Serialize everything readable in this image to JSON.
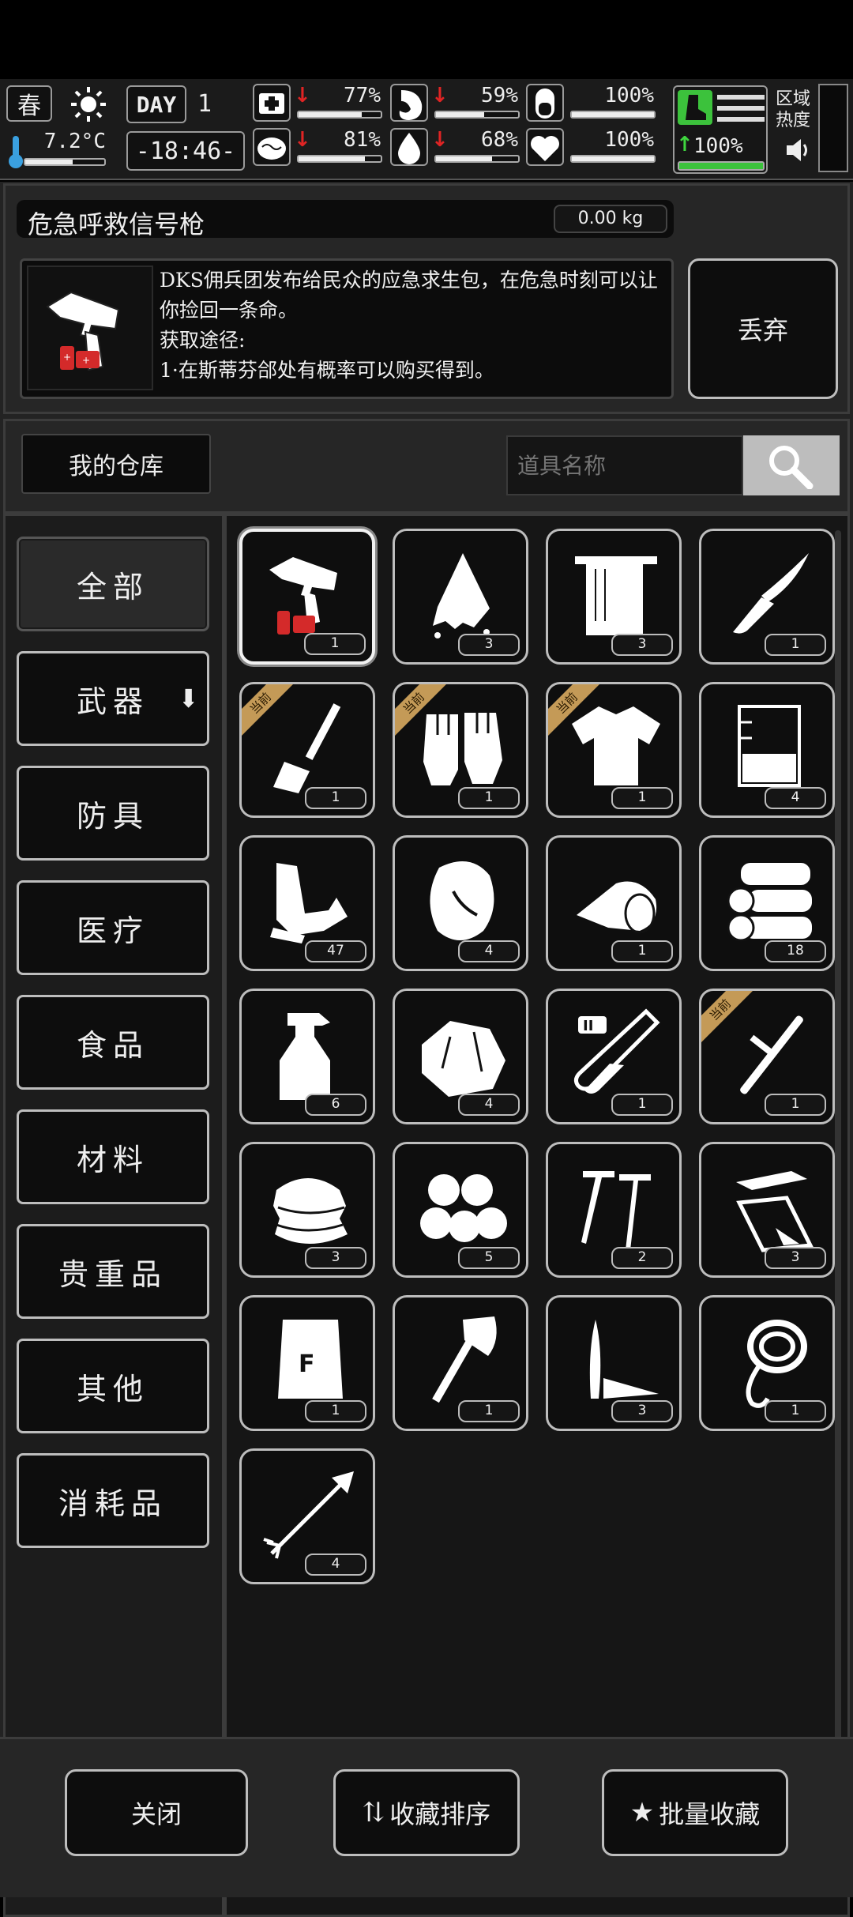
{
  "status": {
    "season": "春",
    "temperature": "7.2°C",
    "day_label": "DAY",
    "day_number": "1",
    "clock": "-18:46-",
    "stats": [
      {
        "icon": "medkit-icon",
        "value": "77%",
        "level": 0.77,
        "trend": "down"
      },
      {
        "icon": "stomach-icon",
        "value": "59%",
        "level": 0.59,
        "trend": "down"
      },
      {
        "icon": "pill-icon",
        "value": "100%",
        "level": 1.0,
        "trend": ""
      },
      {
        "icon": "brain-icon",
        "value": "81%",
        "level": 0.81,
        "trend": "down"
      },
      {
        "icon": "water-drop-icon",
        "value": "68%",
        "level": 0.68,
        "trend": "down"
      },
      {
        "icon": "heart-icon",
        "value": "100%",
        "level": 1.0,
        "trend": ""
      }
    ],
    "stamina": {
      "value": "100%",
      "level": 1.0,
      "trend": "up"
    },
    "zone_label": "区域热度"
  },
  "item": {
    "name": "危急呼救信号枪",
    "weight": "0.00 kg",
    "description": "DKS佣兵团发布给民众的应急求生包，在危急时刻可以让你捡回一条命。",
    "source_title": "获取途径:",
    "source_line": "1·在斯蒂芬郃处有概率可以购买得到。",
    "discard_label": "丢弃"
  },
  "warehouse": {
    "title": "我的仓库",
    "search_placeholder": "道具名称"
  },
  "categories": [
    "全部",
    "武器",
    "防具",
    "医疗",
    "食品",
    "材料",
    "贵重品",
    "其他",
    "消耗品"
  ],
  "current_badge": "当前",
  "items": [
    {
      "icon": "flare-gun-icon",
      "qty": "1",
      "current": false
    },
    {
      "icon": "wet-cloth-icon",
      "qty": "3",
      "current": false
    },
    {
      "icon": "towel-icon",
      "qty": "3",
      "current": false
    },
    {
      "icon": "knife-icon",
      "qty": "1",
      "current": false
    },
    {
      "icon": "shovel-icon",
      "qty": "1",
      "current": true
    },
    {
      "icon": "gloves-icon",
      "qty": "1",
      "current": true
    },
    {
      "icon": "shirt-icon",
      "qty": "1",
      "current": true
    },
    {
      "icon": "beaker-icon",
      "qty": "4",
      "current": false
    },
    {
      "icon": "scrap-metal-icon",
      "qty": "47",
      "current": false
    },
    {
      "icon": "meat-icon",
      "qty": "4",
      "current": false
    },
    {
      "icon": "bandage-roll-icon",
      "qty": "1",
      "current": false
    },
    {
      "icon": "logs-icon",
      "qty": "18",
      "current": false
    },
    {
      "icon": "spray-bottle-icon",
      "qty": "6",
      "current": false
    },
    {
      "icon": "ore-rock-icon",
      "qty": "4",
      "current": false
    },
    {
      "icon": "test-tube-icon",
      "qty": "1",
      "current": false
    },
    {
      "icon": "baton-icon",
      "qty": "1",
      "current": true
    },
    {
      "icon": "cloth-pile-icon",
      "qty": "3",
      "current": false
    },
    {
      "icon": "cotton-balls-icon",
      "qty": "5",
      "current": false
    },
    {
      "icon": "nails-icon",
      "qty": "2",
      "current": false
    },
    {
      "icon": "metal-plates-icon",
      "qty": "3",
      "current": false
    },
    {
      "icon": "flour-sack-icon",
      "qty": "1",
      "current": false
    },
    {
      "icon": "axe-icon",
      "qty": "1",
      "current": false
    },
    {
      "icon": "blades-icon",
      "qty": "3",
      "current": false
    },
    {
      "icon": "rope-hook-icon",
      "qty": "1",
      "current": false
    },
    {
      "icon": "arrow-icon",
      "qty": "4",
      "current": false
    }
  ],
  "footer": {
    "close_label": "关闭",
    "sort_label": "收藏排序",
    "batch_label": "批量收藏"
  }
}
